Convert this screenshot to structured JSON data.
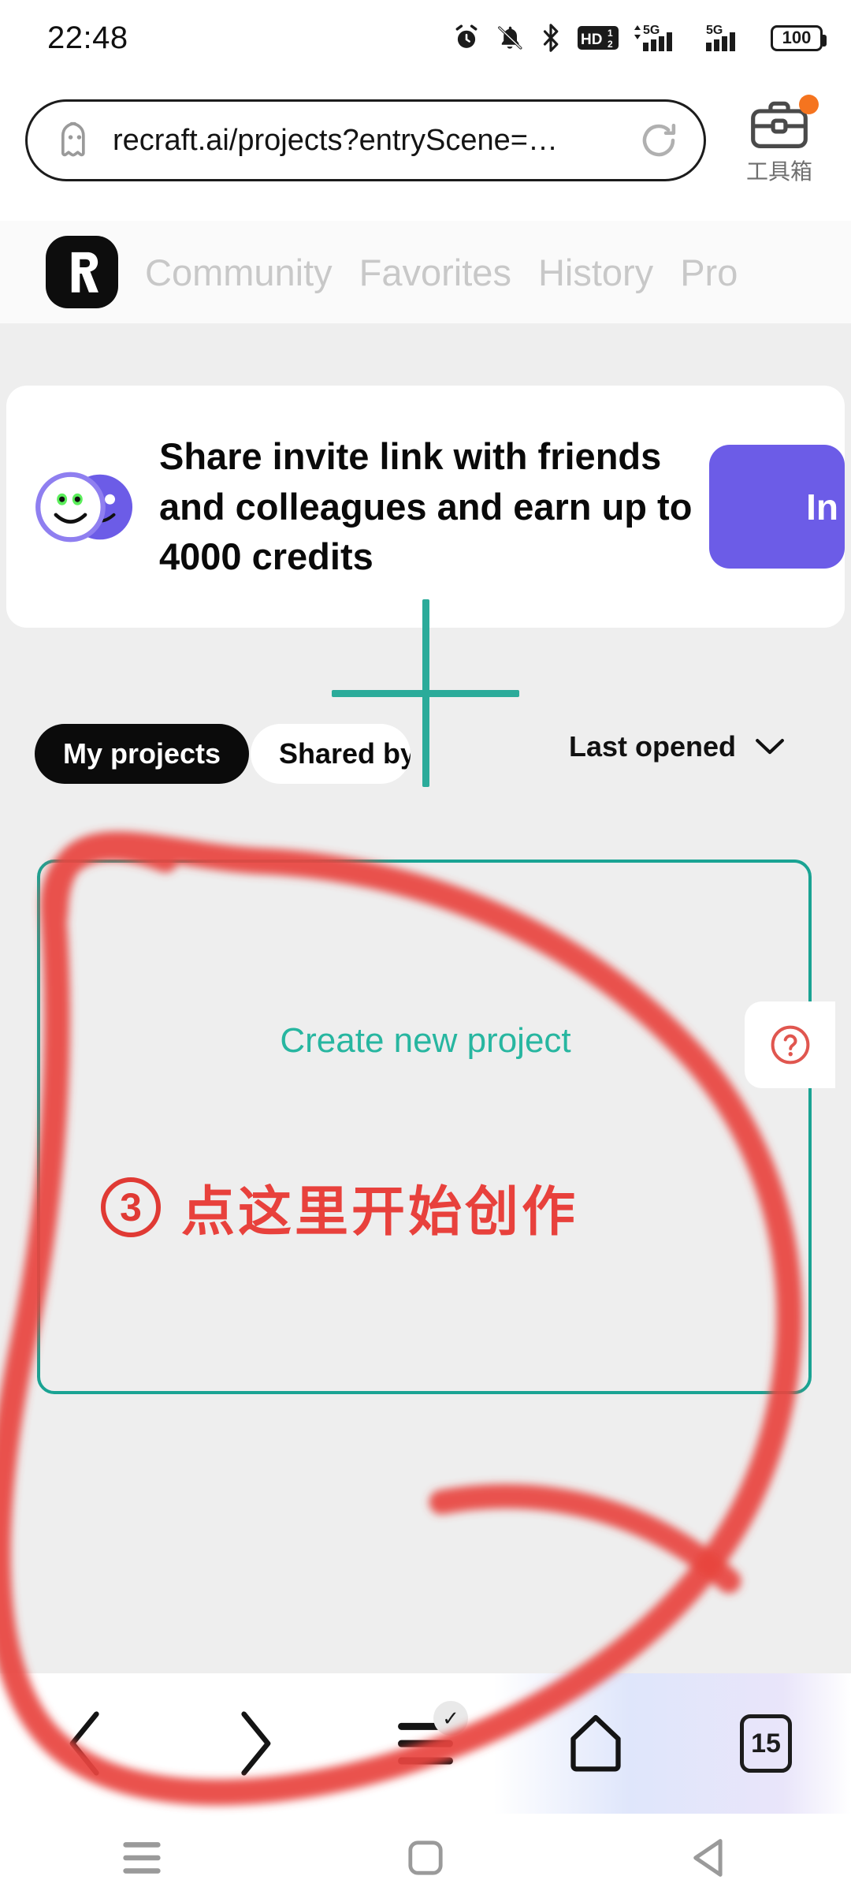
{
  "status_bar": {
    "time": "22:48",
    "battery_level": "100",
    "network_label_primary": "5G",
    "network_label_secondary": "5G",
    "volte_label": "HD",
    "volte_sup": "1",
    "volte_sub": "2",
    "icons": [
      "alarm-icon",
      "bell-muted-icon",
      "bluetooth-icon",
      "hd-volte-icon",
      "signal-5g-icon",
      "signal-5g-icon",
      "battery-icon"
    ]
  },
  "browser": {
    "url": "recraft.ai/projects?entryScene=…",
    "url_icon": "incognito-ghost-icon",
    "reload_icon": "reload-icon",
    "toolbox_label": "工具箱",
    "toolbox_icon": "briefcase-icon",
    "toolbox_has_badge": true,
    "badge_color": "#F5741F",
    "bottom_nav": {
      "back_icon": "chevron-left-icon",
      "forward_icon": "chevron-right-icon",
      "menu_icon": "hamburger-menu-icon",
      "menu_badge_glyph": "✓",
      "home_icon": "home-icon",
      "tab_count": "15"
    }
  },
  "system_nav": {
    "recents_icon": "recents-icon",
    "home_icon": "home-square-icon",
    "back_icon": "back-triangle-icon"
  },
  "site": {
    "brand_name": "Recraft",
    "brand_glyph": "R",
    "tabs": [
      {
        "label": "Community",
        "active": false
      },
      {
        "label": "Favorites",
        "active": false
      },
      {
        "label": "History",
        "active": false
      },
      {
        "label": "Pro",
        "active": false
      }
    ],
    "banner": {
      "headline": "Share invite link with friends and colleagues and earn up to 4000 credits",
      "button_label": "In",
      "button_color": "#6C5CE7",
      "avatar_icon": "two-smiley-faces-icon"
    },
    "filters": {
      "my_projects": "My projects",
      "shared_with_me": "Shared by ",
      "sort_label": "Last opened",
      "sort_chevron": "chevron-down-icon"
    },
    "create_card": {
      "plus_icon": "plus-icon",
      "label": "Create new project",
      "border_color": "#1aa393",
      "label_color": "#27b6a0"
    },
    "help_button": {
      "icon": "question-mark-circle-icon"
    }
  },
  "annotation": {
    "step_number": "③",
    "step_digit": "3",
    "text": "点这里开始创作",
    "color": "#e8413c",
    "shape": "hand-drawn-red-circle"
  }
}
